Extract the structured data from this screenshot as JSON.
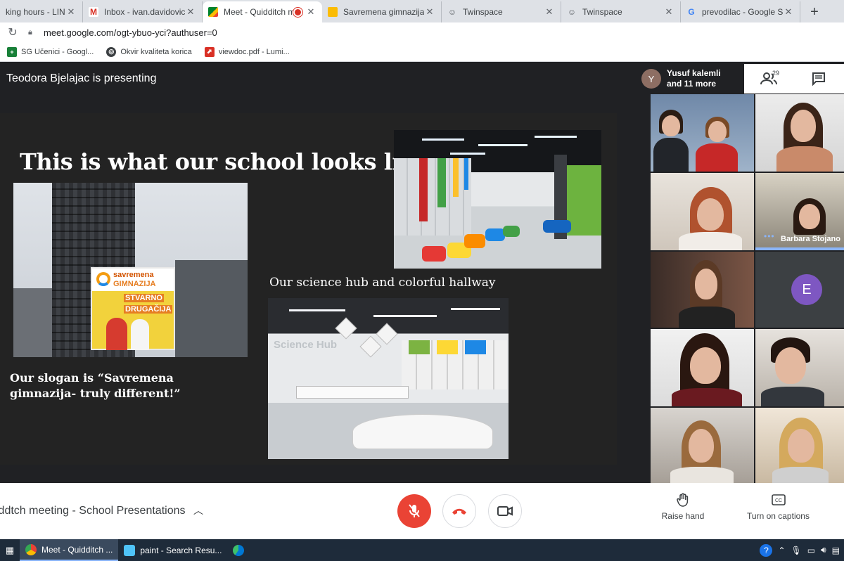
{
  "browser": {
    "tabs": [
      {
        "title": "king hours - LINK g",
        "icon": "link-tab-icon"
      },
      {
        "title": "Inbox - ivan.davidovic@",
        "icon": "gmail-icon"
      },
      {
        "title": "Meet - Quidditch m",
        "icon": "meet-icon",
        "active": true,
        "recording": true
      },
      {
        "title": "Savremena gimnazija- H",
        "icon": "slides-icon"
      },
      {
        "title": "Twinspace",
        "icon": "twinspace-icon"
      },
      {
        "title": "Twinspace",
        "icon": "twinspace-icon"
      },
      {
        "title": "prevodilac - Google Sea",
        "icon": "google-icon"
      }
    ],
    "new_tab": "+",
    "url": "meet.google.com/ogt-ybuo-yci?authuser=0",
    "bookmarks": [
      {
        "label": "SG Učenici - Googl...",
        "color": "#188038"
      },
      {
        "label": "Okvir kvaliteta korica",
        "color": "#3c4043"
      },
      {
        "label": "viewdoc.pdf - Lumi...",
        "color": "#d93025"
      }
    ]
  },
  "meet": {
    "presenting_label": "Teodora Bjelajac is presenting",
    "pinned_participant": {
      "initial": "Y",
      "line1": "Yusuf kalemli",
      "line2": "and 11 more"
    },
    "people_count": "29",
    "slide": {
      "title": "This is what our school looks like:",
      "billboard": {
        "line1": "savremena",
        "line2": "GIMNAZIJA",
        "line3": "STVARNO",
        "line4": "DRUGAČIJA"
      },
      "science_caption": "Our science hub and colorful hallway",
      "lab_sign": "Science Hub",
      "slogan": "Our slogan is “Savremena gimnazija- truly different!”"
    },
    "participants": [
      {
        "speaking_name": "Barbara Stojano"
      },
      {
        "avatar_initial": "E"
      }
    ],
    "meeting_title": "iddtch meeting - School Presentations",
    "controls": {
      "raise_hand": "Raise hand",
      "captions": "Turn on captions"
    }
  },
  "taskbar": {
    "items": [
      {
        "label": "Meet - Quidditch ...",
        "active": true
      },
      {
        "label": "paint - Search Resu..."
      }
    ]
  },
  "colors": {
    "meet_bg": "#202124",
    "mic_off": "#ea4335",
    "hangup": "#ea4335",
    "avatar_e": "#7e57c2"
  }
}
